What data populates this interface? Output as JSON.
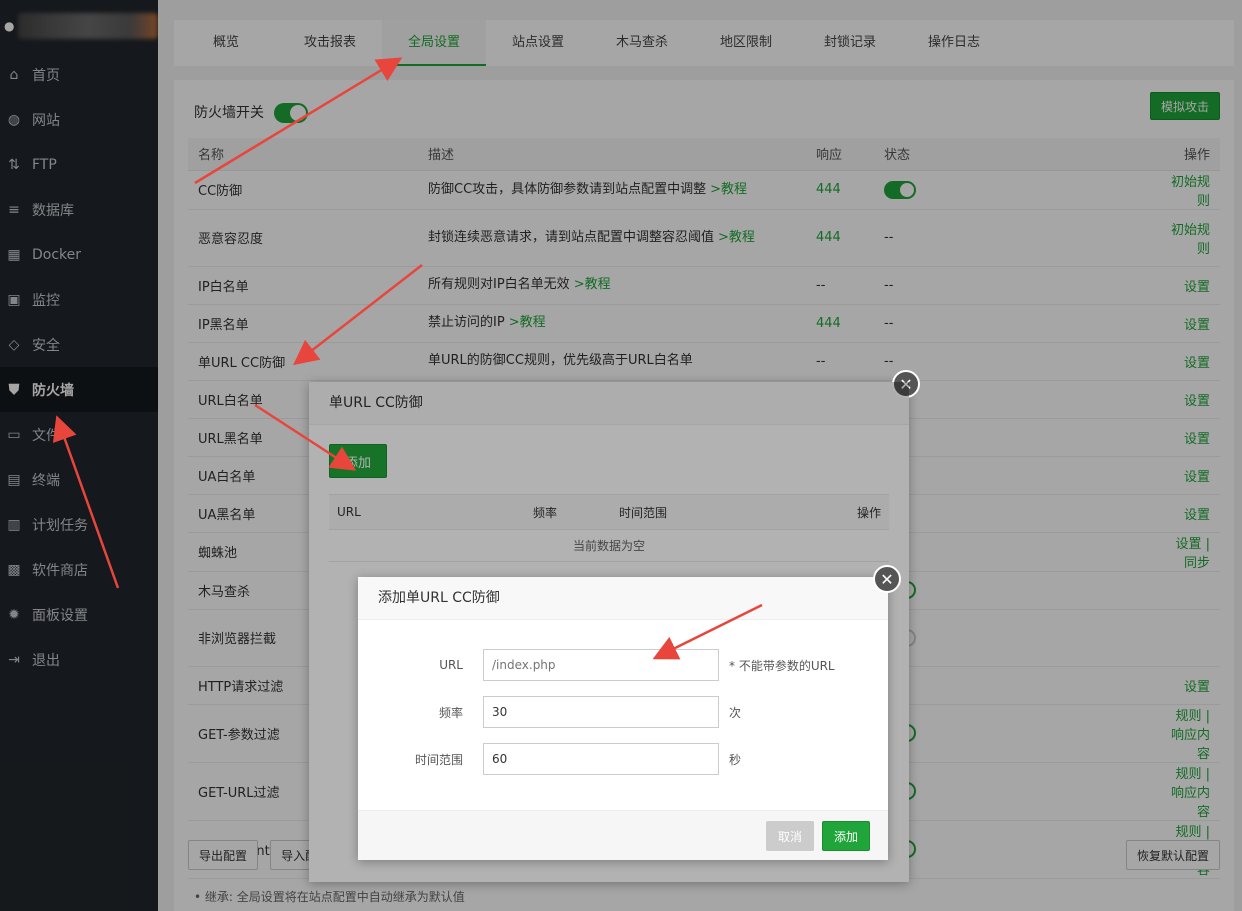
{
  "sidebar": {
    "items": [
      {
        "label": "首页",
        "icon": "home-icon"
      },
      {
        "label": "网站",
        "icon": "globe-icon"
      },
      {
        "label": "FTP",
        "icon": "ftp-icon"
      },
      {
        "label": "数据库",
        "icon": "database-icon"
      },
      {
        "label": "Docker",
        "icon": "docker-icon"
      },
      {
        "label": "监控",
        "icon": "monitor-icon"
      },
      {
        "label": "安全",
        "icon": "shield-icon"
      },
      {
        "label": "防火墙",
        "icon": "firewall-icon",
        "active": true
      },
      {
        "label": "文件",
        "icon": "folder-icon"
      },
      {
        "label": "终端",
        "icon": "terminal-icon"
      },
      {
        "label": "计划任务",
        "icon": "calendar-icon"
      },
      {
        "label": "软件商店",
        "icon": "apps-icon"
      },
      {
        "label": "面板设置",
        "icon": "gear-icon"
      },
      {
        "label": "退出",
        "icon": "logout-icon"
      }
    ]
  },
  "tabs": [
    "概览",
    "攻击报表",
    "全局设置",
    "站点设置",
    "木马查杀",
    "地区限制",
    "封锁记录",
    "操作日志"
  ],
  "active_tab": "全局设置",
  "firewall_switch_label": "防火墙开关",
  "simulate_attack": "模拟攻击",
  "table": {
    "headers": [
      "名称",
      "描述",
      "响应",
      "状态",
      "操作"
    ],
    "rows": [
      {
        "name": "CC防御",
        "desc": "防御CC攻击，具体防御参数请到站点配置中调整",
        "link": ">教程",
        "resp": "444",
        "status": "on",
        "op": "初始规则"
      },
      {
        "name": "恶意容忍度",
        "desc": "封锁连续恶意请求，请到站点配置中调整容忍阈值",
        "link": ">教程",
        "resp": "444",
        "status": "--",
        "op": "初始规则"
      },
      {
        "name": "IP白名单",
        "desc": "所有规则对IP白名单无效",
        "link": ">教程",
        "resp": "--",
        "status": "--",
        "op": "设置"
      },
      {
        "name": "IP黑名单",
        "desc": "禁止访问的IP",
        "link": ">教程",
        "resp": "444",
        "status": "--",
        "op": "设置"
      },
      {
        "name": "单URL CC防御",
        "desc": "单URL的防御CC规则，优先级高于URL白名单",
        "link": "",
        "resp": "--",
        "status": "--",
        "op": "设置"
      },
      {
        "name": "URL白名单",
        "desc": "",
        "link": "",
        "resp": "",
        "status": "",
        "op": "设置"
      },
      {
        "name": "URL黑名单",
        "desc": "",
        "link": "",
        "resp": "",
        "status": "",
        "op": "设置"
      },
      {
        "name": "UA白名单",
        "desc": "",
        "link": "",
        "resp": "",
        "status": "",
        "op": "设置"
      },
      {
        "name": "UA黑名单",
        "desc": "",
        "link": "",
        "resp": "",
        "status": "",
        "op": "设置"
      },
      {
        "name": "蜘蛛池",
        "desc": "",
        "link": "",
        "resp": "",
        "status": "",
        "op": "设置 | 同步"
      },
      {
        "name": "木马查杀",
        "desc": "",
        "link": "",
        "resp": "",
        "status": "on",
        "op": ""
      },
      {
        "name": "非浏览器拦截",
        "desc": "",
        "link": "",
        "resp": "",
        "status": "off",
        "op": ""
      },
      {
        "name": "HTTP请求过滤",
        "desc": "",
        "link": "",
        "resp": "",
        "status": "",
        "op": "设置"
      },
      {
        "name": "GET-参数过滤",
        "desc": "",
        "link": "",
        "resp": "",
        "status": "on",
        "op": "规则 | 响应内容"
      },
      {
        "name": "GET-URL过滤",
        "desc": "",
        "link": "",
        "resp": "",
        "status": "on",
        "op": "规则 | 响应内容"
      },
      {
        "name": "User-Agent过滤",
        "desc": "",
        "link": "",
        "resp": "",
        "status": "on",
        "op": "规则 | 响应内容"
      }
    ]
  },
  "bottom": {
    "export": "导出配置",
    "import": "导入配",
    "restore": "恢复默认配置"
  },
  "note": "继承: 全局设置将在站点配置中自动继承为默认值",
  "dialog1": {
    "title": "单URL CC防御",
    "add": "添加",
    "headers": [
      "URL",
      "频率",
      "时间范围",
      "操作"
    ],
    "empty": "当前数据为空"
  },
  "dialog2": {
    "title": "添加单URL CC防御",
    "fields": [
      {
        "label": "URL",
        "value": "",
        "placeholder": "/index.php",
        "hint": "* 不能带参数的URL"
      },
      {
        "label": "频率",
        "value": "30",
        "placeholder": "",
        "hint": "次"
      },
      {
        "label": "时间范围",
        "value": "60",
        "placeholder": "",
        "hint": "秒"
      }
    ],
    "cancel": "取消",
    "submit": "添加"
  },
  "colors": {
    "accent": "#20a53a",
    "sidebar": "#21262b",
    "annotation": "#e8453c"
  }
}
